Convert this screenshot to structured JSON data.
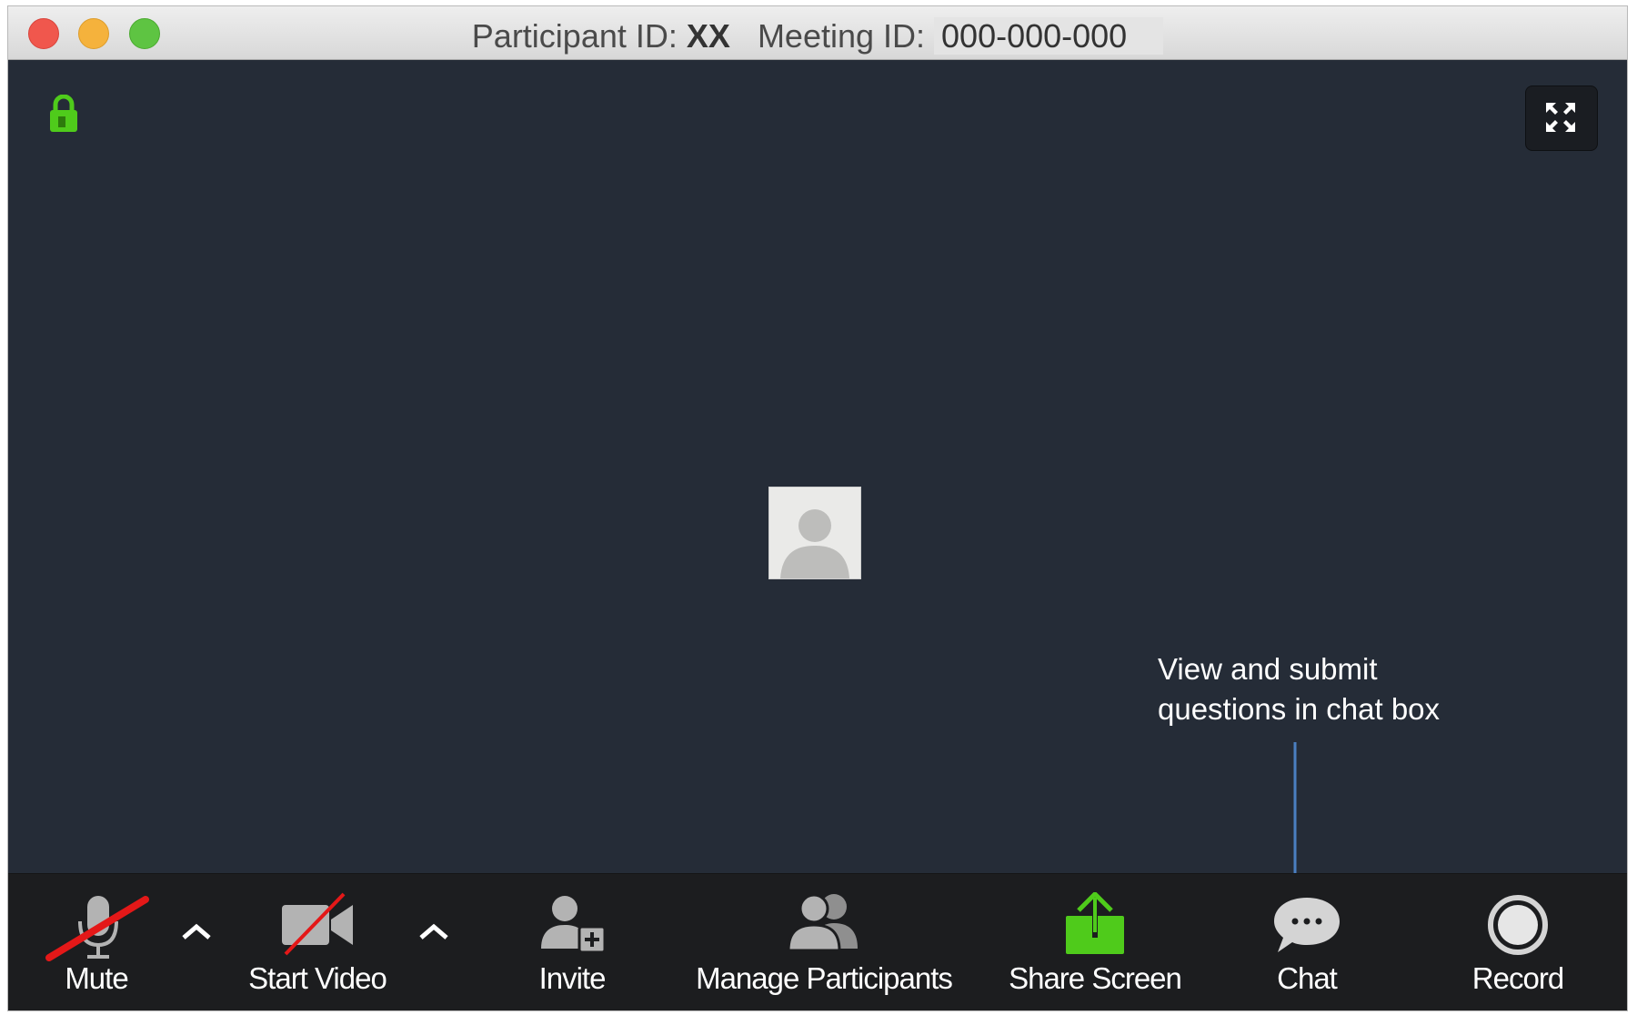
{
  "window": {
    "participant_label": "Participant ID:",
    "participant_value": "XX",
    "meeting_label": "Meeting ID:",
    "meeting_value": "000-000-000"
  },
  "annotation": {
    "line1": "View and submit",
    "line2": "questions in chat box"
  },
  "toolbar": {
    "mute_label": "Mute",
    "start_video_label": "Start Video",
    "invite_label": "Invite",
    "manage_participants_label": "Manage Participants",
    "share_screen_label": "Share Screen",
    "chat_label": "Chat",
    "record_label": "Record"
  },
  "colors": {
    "stage": "#252c37",
    "toolbar": "#1c1d1f",
    "accent_green": "#4fcb1b",
    "mute_slash": "#e41818",
    "arrow": "#4a7fc1"
  },
  "icons": [
    "lock-icon",
    "fullscreen-icon",
    "microphone-icon",
    "video-camera-icon",
    "invite-person-icon",
    "participants-icon",
    "share-screen-icon",
    "chat-bubble-icon",
    "record-icon",
    "chevron-up-icon"
  ]
}
